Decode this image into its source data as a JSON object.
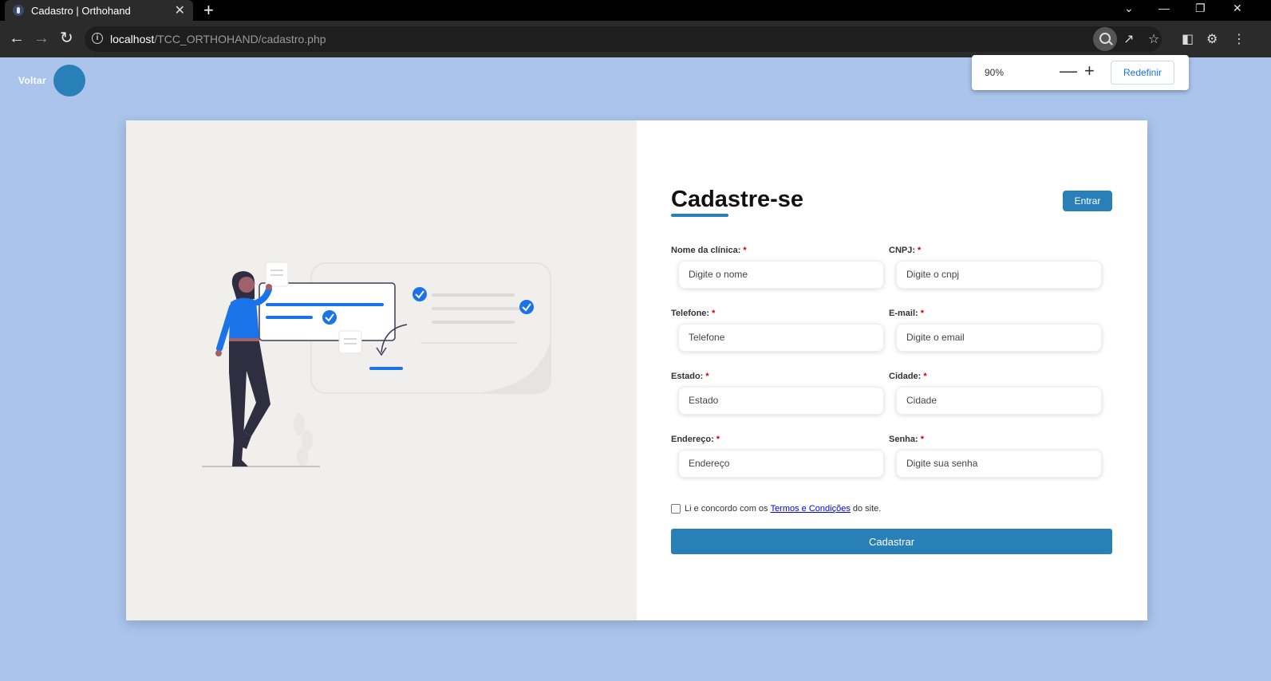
{
  "browser": {
    "tab_title": "Cadastro | Orthohand",
    "tab_close": "✕",
    "new_tab": "+",
    "url_host": "localhost",
    "url_path": "/TCC_ORTHOHAND/cadastro.php",
    "window_minimize": "—",
    "window_restore": "❐",
    "window_close": "✕",
    "tab_dropdown": "⌄",
    "zoom": {
      "value": "90%",
      "minus": "—",
      "plus": "+",
      "reset_label": "Redefinir"
    }
  },
  "page": {
    "back_label": "Voltar",
    "accent_color": "#2980b9",
    "background_color": "#aac4ec"
  },
  "form": {
    "title": "Cadastre-se",
    "login_button": "Entrar",
    "fields": [
      {
        "label": "Nome da clínica:",
        "placeholder": "Digite o nome"
      },
      {
        "label": "CNPJ:",
        "placeholder": "Digite o cnpj"
      },
      {
        "label": "Telefone:",
        "placeholder": "Telefone"
      },
      {
        "label": "E-mail:",
        "placeholder": "Digite o email"
      },
      {
        "label": "Estado:",
        "placeholder": "Estado"
      },
      {
        "label": "Cidade:",
        "placeholder": "Cidade"
      },
      {
        "label": "Endereço:",
        "placeholder": "Endereço"
      },
      {
        "label": "Senha:",
        "placeholder": "Digite sua senha"
      }
    ],
    "required_mark": "*",
    "terms_prefix": "Li e concordo com os",
    "terms_link": "Termos e Condições",
    "terms_suffix": "do site.",
    "submit_button": "Cadastrar"
  }
}
